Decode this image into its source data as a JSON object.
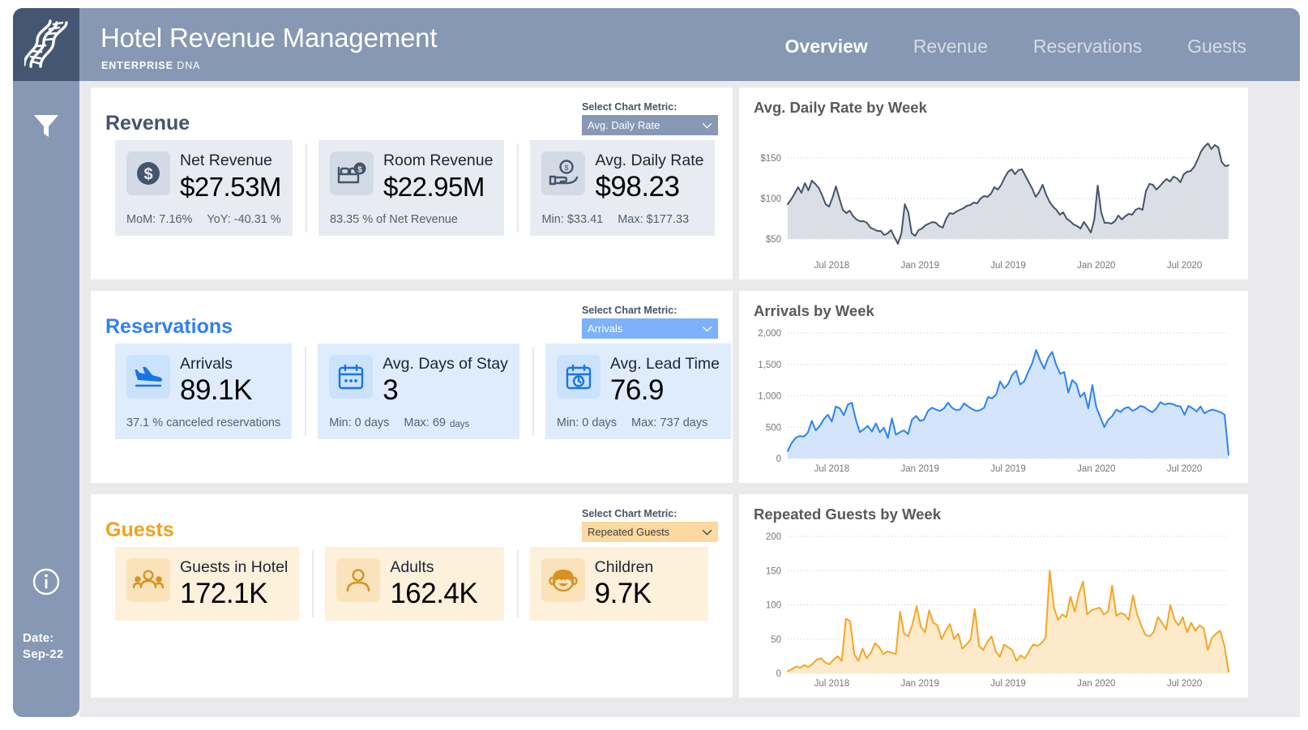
{
  "header": {
    "title": "Hotel Revenue Management",
    "brand_bold": "ENTERPRISE",
    "brand_light": " DNA",
    "logo_icon": "dna-icon",
    "nav": [
      {
        "label": "Overview",
        "active": true
      },
      {
        "label": "Revenue",
        "active": false
      },
      {
        "label": "Reservations",
        "active": false
      },
      {
        "label": "Guests",
        "active": false
      }
    ]
  },
  "sidebar": {
    "filter_icon": "filter-funnel-icon",
    "info_icon": "info-circle-icon",
    "date_label": "Date:",
    "date_value": "Sep-22"
  },
  "sections": [
    {
      "id": "revenue",
      "title": "Revenue",
      "accent": "#44546a",
      "metric_label": "Select Chart Metric:",
      "metric_value": "Avg. Daily Rate",
      "cards": [
        {
          "icon": "dollar-coin-icon",
          "name": "Net Revenue",
          "value": "$27.53M",
          "foot": [
            {
              "text": "MoM: 7.16%"
            },
            {
              "text": "YoY: -40.31 %"
            }
          ]
        },
        {
          "icon": "bed-dollar-icon",
          "name": "Room Revenue",
          "value": "$22.95M",
          "foot": [
            {
              "text": "83.35 % of Net Revenue"
            }
          ]
        },
        {
          "icon": "hand-coin-icon",
          "name": "Avg. Daily Rate",
          "value": "$98.23",
          "foot": [
            {
              "text": "Min: $33.41"
            },
            {
              "text": "Max:  $177.33"
            }
          ]
        }
      ]
    },
    {
      "id": "reservations",
      "title": "Reservations",
      "accent": "#2f80f7",
      "metric_label": "Select Chart Metric:",
      "metric_value": "Arrivals",
      "cards": [
        {
          "icon": "plane-landing-icon",
          "name": "Arrivals",
          "value": "89.1K",
          "foot": [
            {
              "text": "37.1 %  canceled reservations"
            }
          ]
        },
        {
          "icon": "calendar-dots-icon",
          "name": "Avg. Days of Stay",
          "value": "3",
          "foot": [
            {
              "text": "Min: 0 days"
            },
            {
              "text": "Max:  69",
              "suffix": "days"
            }
          ]
        },
        {
          "icon": "calendar-clock-icon",
          "name": "Avg. Lead Time",
          "value": "76.9",
          "foot": [
            {
              "text": "Min: 0 days"
            },
            {
              "text": "Max:  737 days"
            }
          ]
        }
      ]
    },
    {
      "id": "guests",
      "title": "Guests",
      "accent": "#f3a01c",
      "metric_label": "Select Chart Metric:",
      "metric_value": "Repeated Guests",
      "cards": [
        {
          "icon": "people-group-icon",
          "name": "Guests in Hotel",
          "value": "172.1K",
          "foot": []
        },
        {
          "icon": "person-icon",
          "name": "Adults",
          "value": "162.4K",
          "foot": []
        },
        {
          "icon": "child-face-icon",
          "name": "Children",
          "value": "9.7K",
          "foot": []
        }
      ]
    }
  ],
  "chart_data": [
    {
      "type": "area",
      "title": "Avg. Daily Rate by Week",
      "xlabel": "",
      "ylabel": "",
      "ylim": [
        30,
        185
      ],
      "yticks": [
        50,
        100,
        150
      ],
      "ytick_labels": [
        "$50",
        "$100",
        "$150"
      ],
      "xticks": [
        "Jul 2018",
        "Jan 2019",
        "Jul 2019",
        "Jan 2020",
        "Jul 2020"
      ],
      "line_color": "#44546a",
      "fill_color": "#dbdfe5",
      "grid": true,
      "legend": "none",
      "values": [
        93,
        99,
        106,
        114,
        107,
        119,
        110,
        122,
        118,
        113,
        104,
        93,
        90,
        101,
        115,
        100,
        86,
        82,
        85,
        78,
        74,
        72,
        72,
        70,
        64,
        62,
        60,
        60,
        55,
        57,
        61,
        52,
        44,
        57,
        93,
        83,
        57,
        54,
        61,
        63,
        67,
        69,
        71,
        70,
        66,
        64,
        75,
        82,
        81,
        84,
        86,
        88,
        91,
        92,
        95,
        94,
        100,
        103,
        102,
        106,
        114,
        111,
        117,
        126,
        133,
        136,
        130,
        135,
        136,
        128,
        120,
        112,
        102,
        108,
        117,
        105,
        96,
        90,
        86,
        80,
        83,
        75,
        72,
        68,
        66,
        63,
        71,
        65,
        58,
        74,
        116,
        83,
        70,
        70,
        69,
        72,
        79,
        74,
        78,
        81,
        80,
        86,
        88,
        86,
        109,
        118,
        117,
        111,
        115,
        120,
        124,
        121,
        127,
        125,
        120,
        130,
        133,
        134,
        139,
        148,
        158,
        164,
        168,
        161,
        166,
        163,
        145,
        140,
        141
      ]
    },
    {
      "type": "area",
      "title": "Arrivals by Week",
      "xlabel": "",
      "ylabel": "",
      "ylim": [
        0,
        2000
      ],
      "yticks": [
        0,
        500,
        1000,
        1500,
        2000
      ],
      "ytick_labels": [
        "0",
        "500",
        "1,000",
        "1,500",
        "2,000"
      ],
      "xticks": [
        "Jul 2018",
        "Jan 2019",
        "Jul 2019",
        "Jan 2020",
        "Jul 2020"
      ],
      "line_color": "#2a84f0",
      "fill_color": "#d3e4fb",
      "grid": true,
      "legend": "none",
      "values": [
        120,
        250,
        330,
        360,
        350,
        410,
        600,
        450,
        520,
        630,
        700,
        590,
        830,
        800,
        690,
        860,
        890,
        620,
        420,
        470,
        520,
        430,
        560,
        420,
        490,
        330,
        640,
        380,
        420,
        450,
        390,
        620,
        680,
        600,
        620,
        760,
        810,
        780,
        760,
        800,
        890,
        810,
        770,
        780,
        880,
        830,
        790,
        760,
        770,
        810,
        980,
        960,
        1020,
        1230,
        1120,
        1190,
        1330,
        1400,
        1180,
        1230,
        1380,
        1520,
        1730,
        1560,
        1430,
        1610,
        1700,
        1490,
        1350,
        1380,
        1050,
        1250,
        1190,
        980,
        1050,
        800,
        1170,
        820,
        660,
        500,
        620,
        680,
        780,
        740,
        800,
        820,
        760,
        790,
        840,
        820,
        770,
        740,
        800,
        900,
        860,
        880,
        870,
        840,
        830,
        700,
        840,
        800,
        750,
        830,
        720,
        760,
        780,
        760,
        740,
        700,
        60
      ]
    },
    {
      "type": "area",
      "title": "Repeated Guests by Week",
      "xlabel": "",
      "ylabel": "",
      "ylim": [
        0,
        200
      ],
      "yticks": [
        0,
        50,
        100,
        150,
        200
      ],
      "ytick_labels": [
        "0",
        "50",
        "100",
        "150",
        "200"
      ],
      "xticks": [
        "Jul 2018",
        "Jan 2019",
        "Jul 2019",
        "Jan 2020",
        "Jul 2020"
      ],
      "line_color": "#f5a623",
      "fill_color": "#fdeacb",
      "grid": true,
      "legend": "none",
      "values": [
        3,
        6,
        10,
        8,
        12,
        9,
        14,
        20,
        22,
        16,
        13,
        20,
        25,
        18,
        80,
        76,
        28,
        18,
        36,
        22,
        30,
        44,
        38,
        28,
        32,
        30,
        28,
        90,
        58,
        54,
        72,
        98,
        68,
        60,
        92,
        74,
        70,
        50,
        62,
        72,
        50,
        58,
        36,
        42,
        50,
        94,
        40,
        34,
        46,
        54,
        32,
        24,
        42,
        38,
        34,
        18,
        26,
        22,
        32,
        42,
        40,
        44,
        52,
        150,
        96,
        78,
        86,
        82,
        112,
        90,
        116,
        134,
        86,
        92,
        94,
        96,
        86,
        90,
        128,
        84,
        88,
        86,
        78,
        114,
        86,
        70,
        56,
        54,
        60,
        82,
        74,
        64,
        100,
        78,
        70,
        82,
        60,
        74,
        62,
        70,
        66,
        34,
        52,
        58,
        62,
        40,
        2
      ]
    }
  ]
}
